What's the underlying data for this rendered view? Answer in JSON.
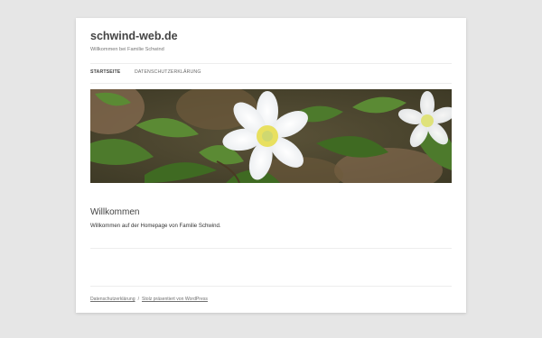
{
  "site": {
    "title": "schwind-web.de",
    "description": "Willkommen bei Familie Schwind"
  },
  "nav": {
    "items": [
      {
        "label": "STARTSEITE",
        "current": true
      },
      {
        "label": "DATENSCHUTZERKLÄRUNG",
        "current": false
      }
    ]
  },
  "header_image": {
    "icon": "anemone-flowers-photo",
    "colors": {
      "petal": "#ffffff",
      "leaf": "#4a7a2a",
      "background": "#6a5a3a",
      "stamen": "#e8e060"
    }
  },
  "content": {
    "title": "Willkommen",
    "text": "Willkommen auf der Homepage von Familie Schwind."
  },
  "footer": {
    "privacy_link": "Datenschutzerklärung",
    "separator": "/",
    "wordpress_link": "Stolz präsentiert von WordPress"
  }
}
